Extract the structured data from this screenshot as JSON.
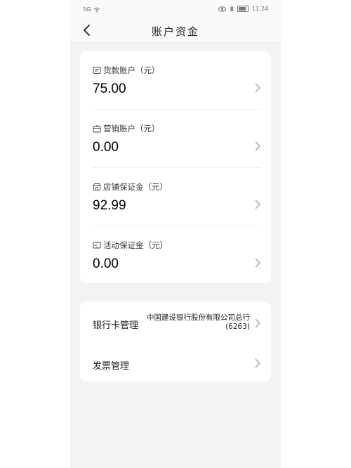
{
  "status_bar": {
    "signal": "5G",
    "time": "11:24"
  },
  "nav": {
    "title": "账户资金"
  },
  "accounts": [
    {
      "label": "货款账户（元）",
      "value": "75.00",
      "icon": "ledger-icon"
    },
    {
      "label": "营销账户（元）",
      "value": "0.00",
      "icon": "gift-box-icon"
    },
    {
      "label": "店铺保证金（元）",
      "value": "92.99",
      "icon": "store-icon"
    },
    {
      "label": "活动保证金（元）",
      "value": "0.00",
      "icon": "ticket-icon"
    }
  ],
  "menu": {
    "bank_card": {
      "label": "银行卡管理",
      "bank_name": "中国建设银行股份有限公司总行",
      "card_tail": "(6263)"
    },
    "invoice": {
      "label": "发票管理"
    }
  },
  "colors": {
    "background": "#f3f3f3",
    "card": "#ffffff",
    "chevron": "#b0b0b0"
  }
}
